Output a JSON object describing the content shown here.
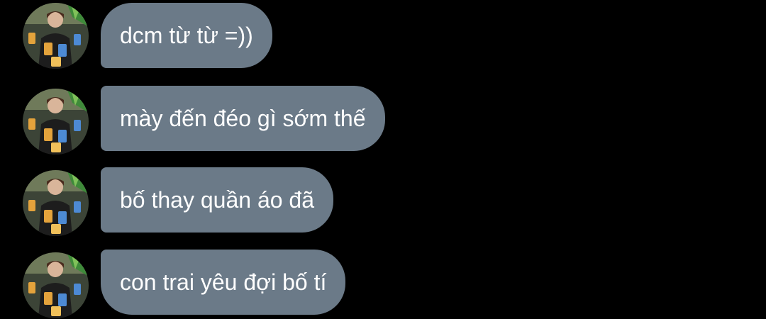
{
  "conversation": {
    "messages": [
      {
        "text": "dcm từ từ =))",
        "avatar_icon": "user-avatar-icon"
      },
      {
        "text": "mày đến đéo gì sớm thế",
        "avatar_icon": "user-avatar-icon"
      },
      {
        "text": "bố thay quần áo đã",
        "avatar_icon": "user-avatar-icon"
      },
      {
        "text": "con trai yêu đợi bố tí",
        "avatar_icon": "user-avatar-icon"
      }
    ],
    "colors": {
      "background": "#000000",
      "bubble": "#6b7a88",
      "text": "#ffffff"
    }
  }
}
